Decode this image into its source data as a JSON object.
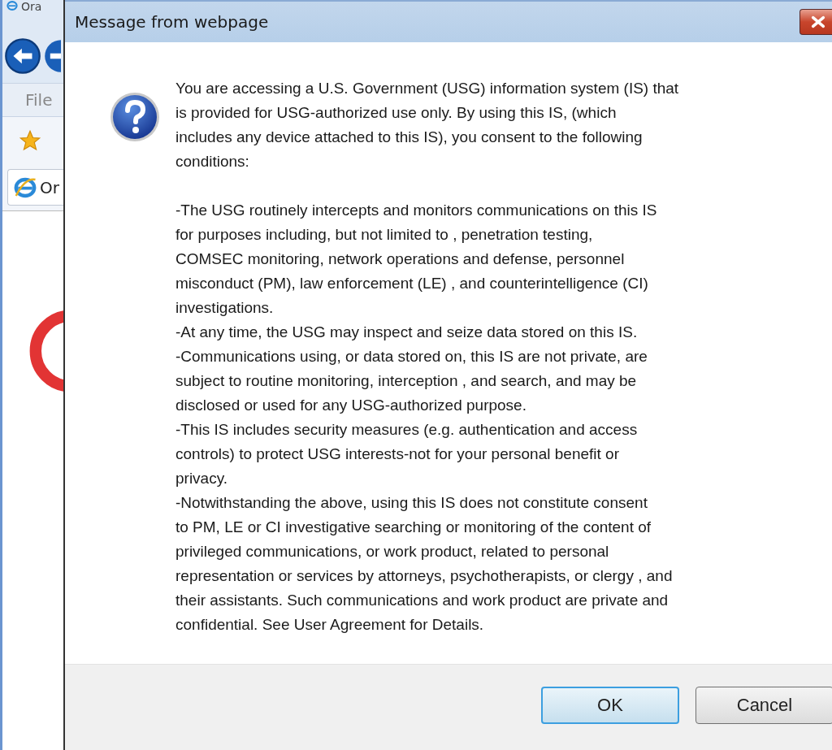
{
  "browser": {
    "window_title": "Ora",
    "menu": [
      "File"
    ],
    "tab": {
      "label": "Or",
      "selected": true
    }
  },
  "dialog": {
    "title": "Message from webpage",
    "message": [
      [
        "You are accessing a U.S. Government (USG) information system (IS) that",
        "is provided for USG-authorized use only. By using this IS, (which",
        "includes any device attached to this IS), you consent to the following",
        "conditions:"
      ],
      [
        "-The USG routinely intercepts and monitors communications on this IS",
        "for purposes including, but not limited to , penetration testing,",
        "COMSEC monitoring, network operations and defense, personnel",
        "misconduct (PM), law enforcement (LE) , and counterintelligence (CI)",
        "investigations."
      ],
      [
        "-At any time, the USG may inspect and seize data stored on this IS."
      ],
      [
        "-Communications using, or data stored on, this IS are not private, are",
        "subject to routine monitoring, interception , and search, and may be",
        "disclosed or used for any USG-authorized purpose."
      ],
      [
        "-This IS includes security measures (e.g. authentication and access",
        "controls) to protect USG interests-not for your personal benefit or",
        "privacy."
      ],
      [
        "-Notwithstanding the above, using this IS does not constitute consent",
        "to PM, LE or CI investigative searching or monitoring of the content of",
        "privileged communications, or work product, related to personal",
        "representation or services by attorneys, psychotherapists, or clergy , and",
        "their assistants. Such communications and work product are private and",
        "confidential. See User Agreement for Details."
      ]
    ],
    "buttons": [
      {
        "label": "OK",
        "selected": true
      },
      {
        "label": "Cancel",
        "selected": false
      }
    ]
  }
}
